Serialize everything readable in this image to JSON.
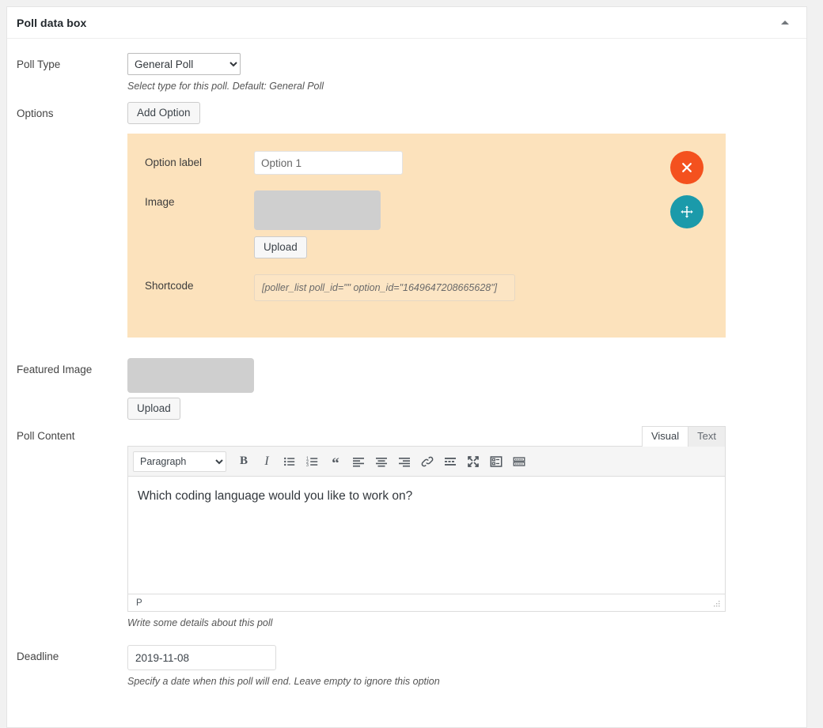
{
  "panel": {
    "title": "Poll data box",
    "collapse_icon": "caret-up-icon"
  },
  "fields": {
    "poll_type": {
      "label": "Poll Type",
      "value": "General Poll",
      "options": [
        "General Poll"
      ],
      "help": "Select type for this poll. Default: General Poll"
    },
    "options": {
      "label": "Options",
      "add_button": "Add Option"
    },
    "featured_image": {
      "label": "Featured Image",
      "upload_button": "Upload"
    },
    "poll_content": {
      "label": "Poll Content",
      "help": "Write some details about this poll"
    },
    "deadline": {
      "label": "Deadline",
      "value": "2019-11-08",
      "help": "Specify a date when this poll will end. Leave empty to ignore this option"
    }
  },
  "option_item": {
    "option_label": {
      "label": "Option label",
      "value": "Option 1",
      "placeholder": "Option 1"
    },
    "image": {
      "label": "Image",
      "upload_button": "Upload"
    },
    "shortcode": {
      "label": "Shortcode",
      "value": "[poller_list poll_id=\"\" option_id=\"1649647208665628\"]"
    },
    "actions": {
      "remove": "remove-option-icon",
      "move": "drag-move-icon"
    }
  },
  "editor": {
    "tabs": [
      {
        "label": "Visual",
        "active": true
      },
      {
        "label": "Text",
        "active": false
      }
    ],
    "format_select": {
      "value": "Paragraph",
      "options": [
        "Paragraph"
      ]
    },
    "toolbar": [
      {
        "name": "bold-icon",
        "glyph": "B"
      },
      {
        "name": "italic-icon",
        "glyph": "I"
      },
      {
        "name": "bulleted-list-icon",
        "glyph": ""
      },
      {
        "name": "numbered-list-icon",
        "glyph": ""
      },
      {
        "name": "blockquote-icon",
        "glyph": "“"
      },
      {
        "name": "align-left-icon",
        "glyph": ""
      },
      {
        "name": "align-center-icon",
        "glyph": ""
      },
      {
        "name": "align-right-icon",
        "glyph": ""
      },
      {
        "name": "insert-link-icon",
        "glyph": ""
      },
      {
        "name": "read-more-icon",
        "glyph": ""
      },
      {
        "name": "fullscreen-icon",
        "glyph": ""
      },
      {
        "name": "special-character-icon",
        "glyph": ""
      },
      {
        "name": "toolbar-toggle-icon",
        "glyph": ""
      }
    ],
    "content": "Which coding language would you like to work on?",
    "status_path": "P"
  },
  "colors": {
    "option_panel_bg": "#fce2bc",
    "remove_button": "#f4511e",
    "move_button": "#1b9aaa",
    "page_bg": "#f1f1f1",
    "card_bg": "#ffffff",
    "image_placeholder": "#cfcfcf"
  }
}
